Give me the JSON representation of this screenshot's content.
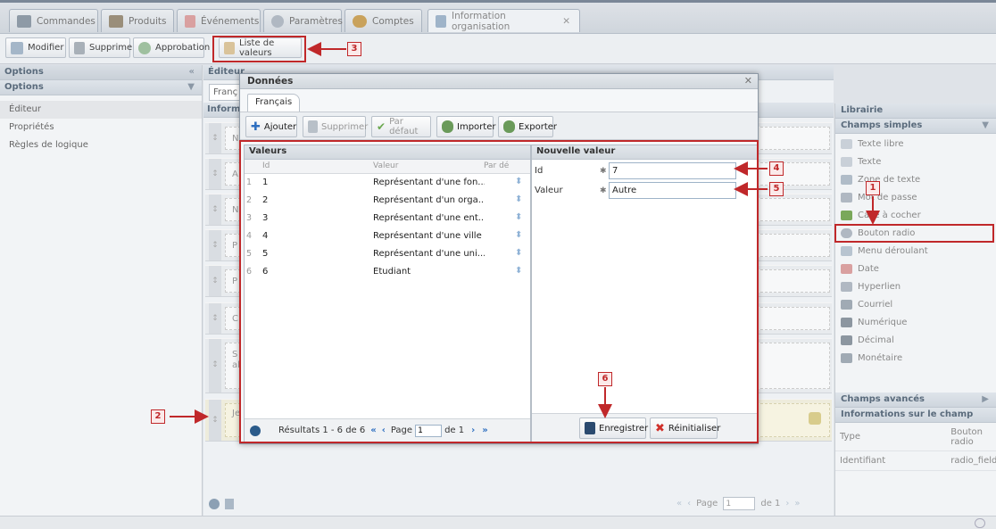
{
  "tabs": [
    {
      "label": "Commandes",
      "icon": "drawer-icon",
      "color": "#8e9aa6"
    },
    {
      "label": "Produits",
      "icon": "box-icon",
      "color": "#9a8e7a"
    },
    {
      "label": "Événements",
      "icon": "calendar-icon",
      "color": "#d9a0a0"
    },
    {
      "label": "Paramètres",
      "icon": "wrench-icon",
      "color": "#b0b8c2"
    },
    {
      "label": "Comptes",
      "icon": "users-icon",
      "color": "#c9a25c"
    },
    {
      "label": "Information organisation",
      "icon": "form-icon",
      "color": "#9fb4c9"
    }
  ],
  "toolbar": {
    "modify": "Modifier",
    "delete": "Supprimer",
    "approval": "Approbation",
    "value_list": "Liste de valeurs"
  },
  "left": {
    "header1": "Options",
    "header2": "Options",
    "items": [
      "Éditeur",
      "Propriétés",
      "Règles de logique"
    ]
  },
  "center": {
    "header": "Éditeur",
    "tab": "Franç",
    "subheader": "Inform",
    "row_letters": [
      "N",
      "A",
      "N",
      "P",
      "P",
      "C",
      "S\nal",
      "Je"
    ]
  },
  "right": {
    "library": "Librairie",
    "simple": "Champs simples",
    "items": [
      {
        "label": "Texte libre",
        "icon": "text-block-icon"
      },
      {
        "label": "Texte",
        "icon": "text-line-icon"
      },
      {
        "label": "Zone de texte",
        "icon": "textarea-icon"
      },
      {
        "label": "Mot de passe",
        "icon": "key-icon"
      },
      {
        "label": "Case à cocher",
        "icon": "checkbox-icon"
      },
      {
        "label": "Bouton radio",
        "icon": "radio-icon"
      },
      {
        "label": "Menu déroulant",
        "icon": "dropdown-icon"
      },
      {
        "label": "Date",
        "icon": "calendar-icon"
      },
      {
        "label": "Hyperlien",
        "icon": "link-icon"
      },
      {
        "label": "Courriel",
        "icon": "at-icon"
      },
      {
        "label": "Numérique",
        "icon": "number-icon"
      },
      {
        "label": "Décimal",
        "icon": "decimal-icon"
      },
      {
        "label": "Monétaire",
        "icon": "money-icon"
      }
    ],
    "advanced": "Champs avancés",
    "info": "Informations sur le champ",
    "props": [
      {
        "k": "Type",
        "v": "Bouton radio"
      },
      {
        "k": "Identifiant",
        "v": "radio_field"
      }
    ]
  },
  "bottom_pager": {
    "page": "Page",
    "page_value": "1",
    "of": "de 1"
  },
  "modal": {
    "title": "Données",
    "tab": "Français",
    "buttons": {
      "add": "Ajouter",
      "delete": "Supprimer",
      "default": "Par défaut",
      "import": "Importer",
      "export": "Exporter"
    },
    "grid": {
      "title": "Valeurs",
      "cols": {
        "id": "Id",
        "value": "Valeur",
        "default": "Par dé"
      },
      "rows": [
        {
          "n": "1",
          "id": "1",
          "value": "Représentant d'une fon..."
        },
        {
          "n": "2",
          "id": "2",
          "value": "Représentant d'un orga..."
        },
        {
          "n": "3",
          "id": "3",
          "value": "Représentant d'une ent..."
        },
        {
          "n": "4",
          "id": "4",
          "value": "Représentant d'une ville"
        },
        {
          "n": "5",
          "id": "5",
          "value": "Représentant d'une uni..."
        },
        {
          "n": "6",
          "id": "6",
          "value": "Étudiant"
        }
      ],
      "results": "Résultats 1 - 6 de 6",
      "page": "Page",
      "page_value": "1",
      "of": "de 1"
    },
    "form": {
      "title": "Nouvelle valeur",
      "id_label": "Id",
      "id_value": "7",
      "value_label": "Valeur",
      "value_value": "Autre",
      "save": "Enregistrer",
      "reset": "Réinitialiser"
    }
  },
  "annotations": [
    "1",
    "2",
    "3",
    "4",
    "5",
    "6"
  ],
  "colors": {
    "annotation": "#c0282a",
    "accent": "#9eb3c8"
  }
}
